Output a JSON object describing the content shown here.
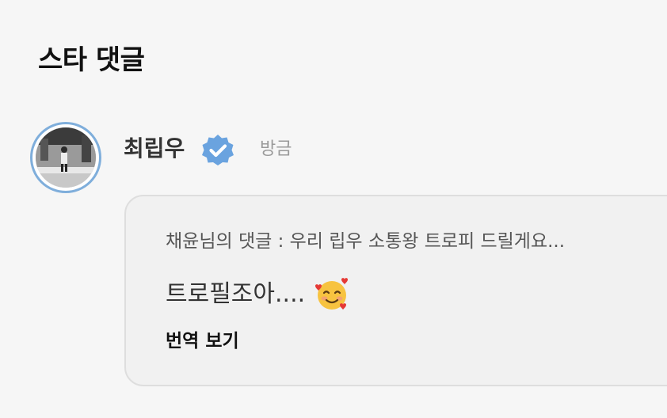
{
  "section": {
    "title": "스타 댓글"
  },
  "comment": {
    "author": "최립우",
    "timestamp": "방금",
    "reply_context": "채윤님의 댓글 : 우리 립우 소통왕 트로피 드릴게요...",
    "text": "트로필조아....",
    "emoji": "smiling-face-with-hearts-icon",
    "translate_label": "번역 보기"
  },
  "colors": {
    "verified": "#6aa3df",
    "avatar_ring": "#7faedb",
    "background": "#f6f6f6",
    "card": "#f1f1f1"
  }
}
